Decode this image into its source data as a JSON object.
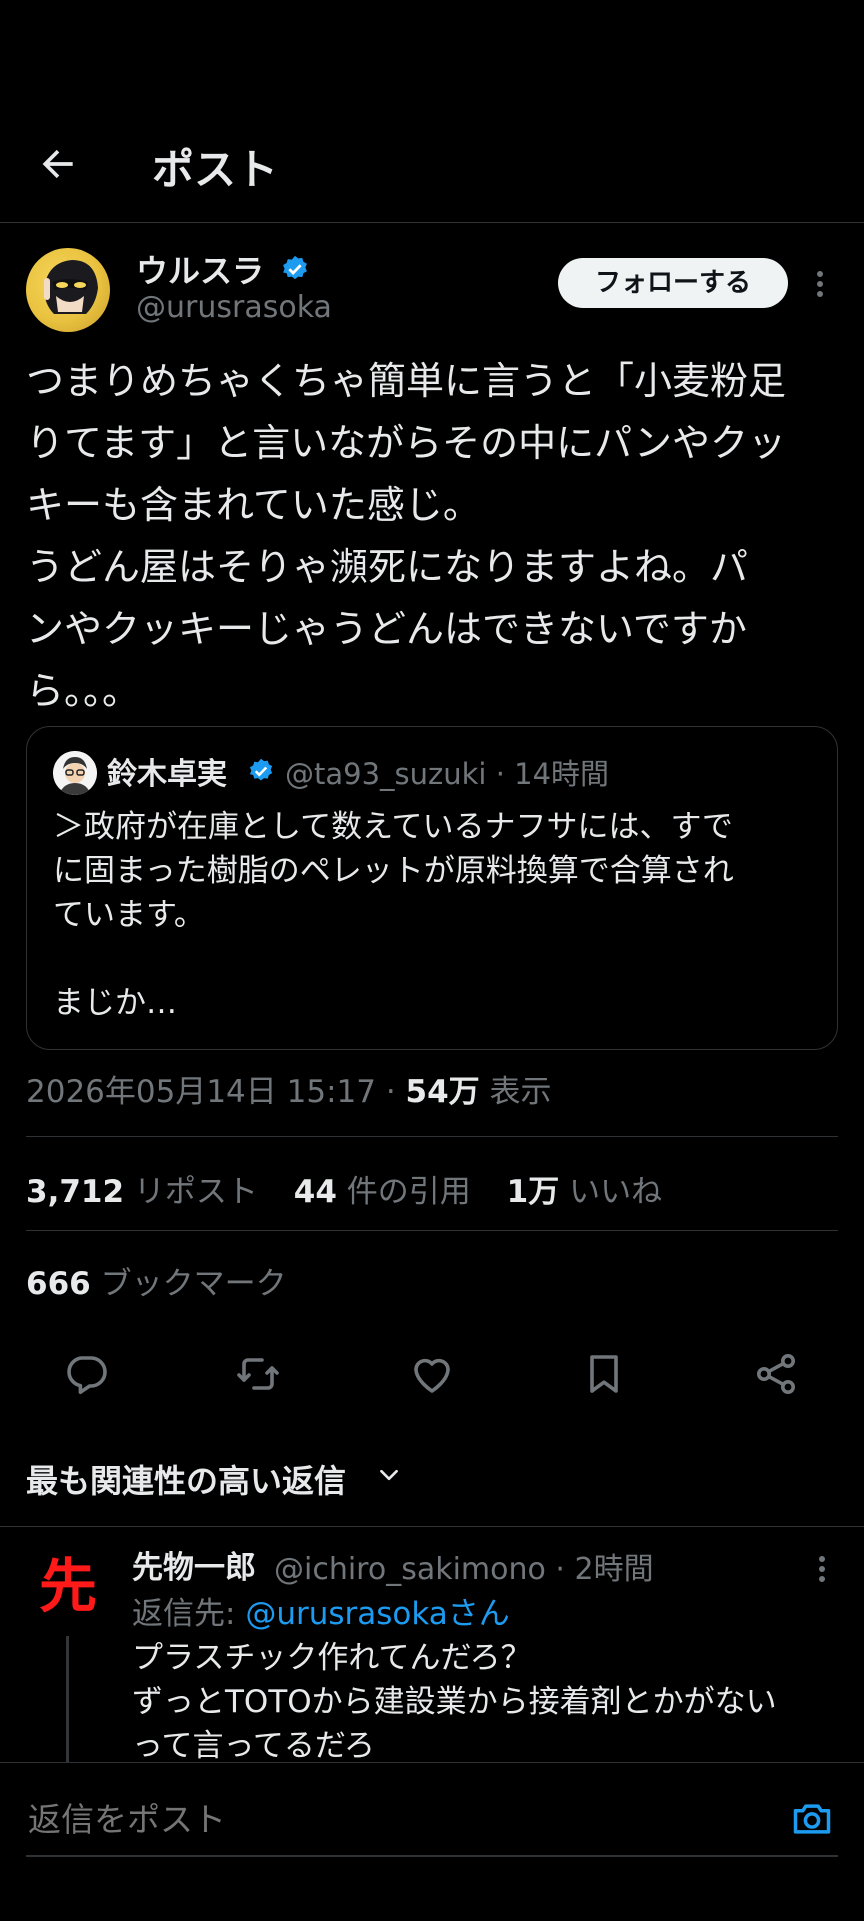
{
  "header": {
    "title": "ポスト"
  },
  "author": {
    "name": "ウルスラ",
    "handle": "@urusrasoka",
    "follow_label": "フォローする"
  },
  "post": {
    "body": "つまりめちゃくちゃ簡単に言うと「小麦粉足\nりてます」と言いながらその中にパンやクッ\nキーも含まれていた感じ。\nうどん屋はそりゃ瀕死になりますよね。パ\nンやクッキーじゃうどんはできないですか\nら。。。"
  },
  "quote": {
    "name": "鈴木卓実",
    "handle": "@ta93_suzuki",
    "time": "14時間",
    "body": "＞政府が在庫として数えているナフサには、すで\nに固まった樹脂のペレットが原料換算で合算され\nています。\n\nまじか…"
  },
  "meta": {
    "datetime": "2026年05月14日 15:17",
    "views_count": "54万",
    "views_label": "表示"
  },
  "stats": {
    "reposts_count": "3,712",
    "reposts_label": "リポスト",
    "quotes_count": "44",
    "quotes_label": "件の引用",
    "likes_count": "1万",
    "likes_label": "いいね",
    "bookmarks_count": "666",
    "bookmarks_label": "ブックマーク"
  },
  "replies_sort": {
    "label": "最も関連性の高い返信"
  },
  "reply": {
    "avatar_char": "先",
    "name": "先物一郎",
    "handle": "@ichiro_sakimono",
    "time": "2時間",
    "reply_to_label": "返信先:",
    "reply_to_handle": "@urusrasokaさん",
    "body": "プラスチック作れてんだろ？\nずっとTOTOから建設業から接着剤とかがない\nって言ってるだろ"
  },
  "compose": {
    "placeholder": "返信をポスト"
  },
  "colors": {
    "accent": "#1d9bf0",
    "background": "#000000",
    "text": "#e7e9ea",
    "muted": "#71767b",
    "reply_avatar": "#ff1a1a"
  },
  "icons": [
    "back-arrow-icon",
    "verified-badge-icon",
    "more-icon",
    "reply-icon",
    "repost-icon",
    "like-icon",
    "bookmark-icon",
    "share-icon",
    "chevron-down-icon",
    "camera-icon"
  ]
}
